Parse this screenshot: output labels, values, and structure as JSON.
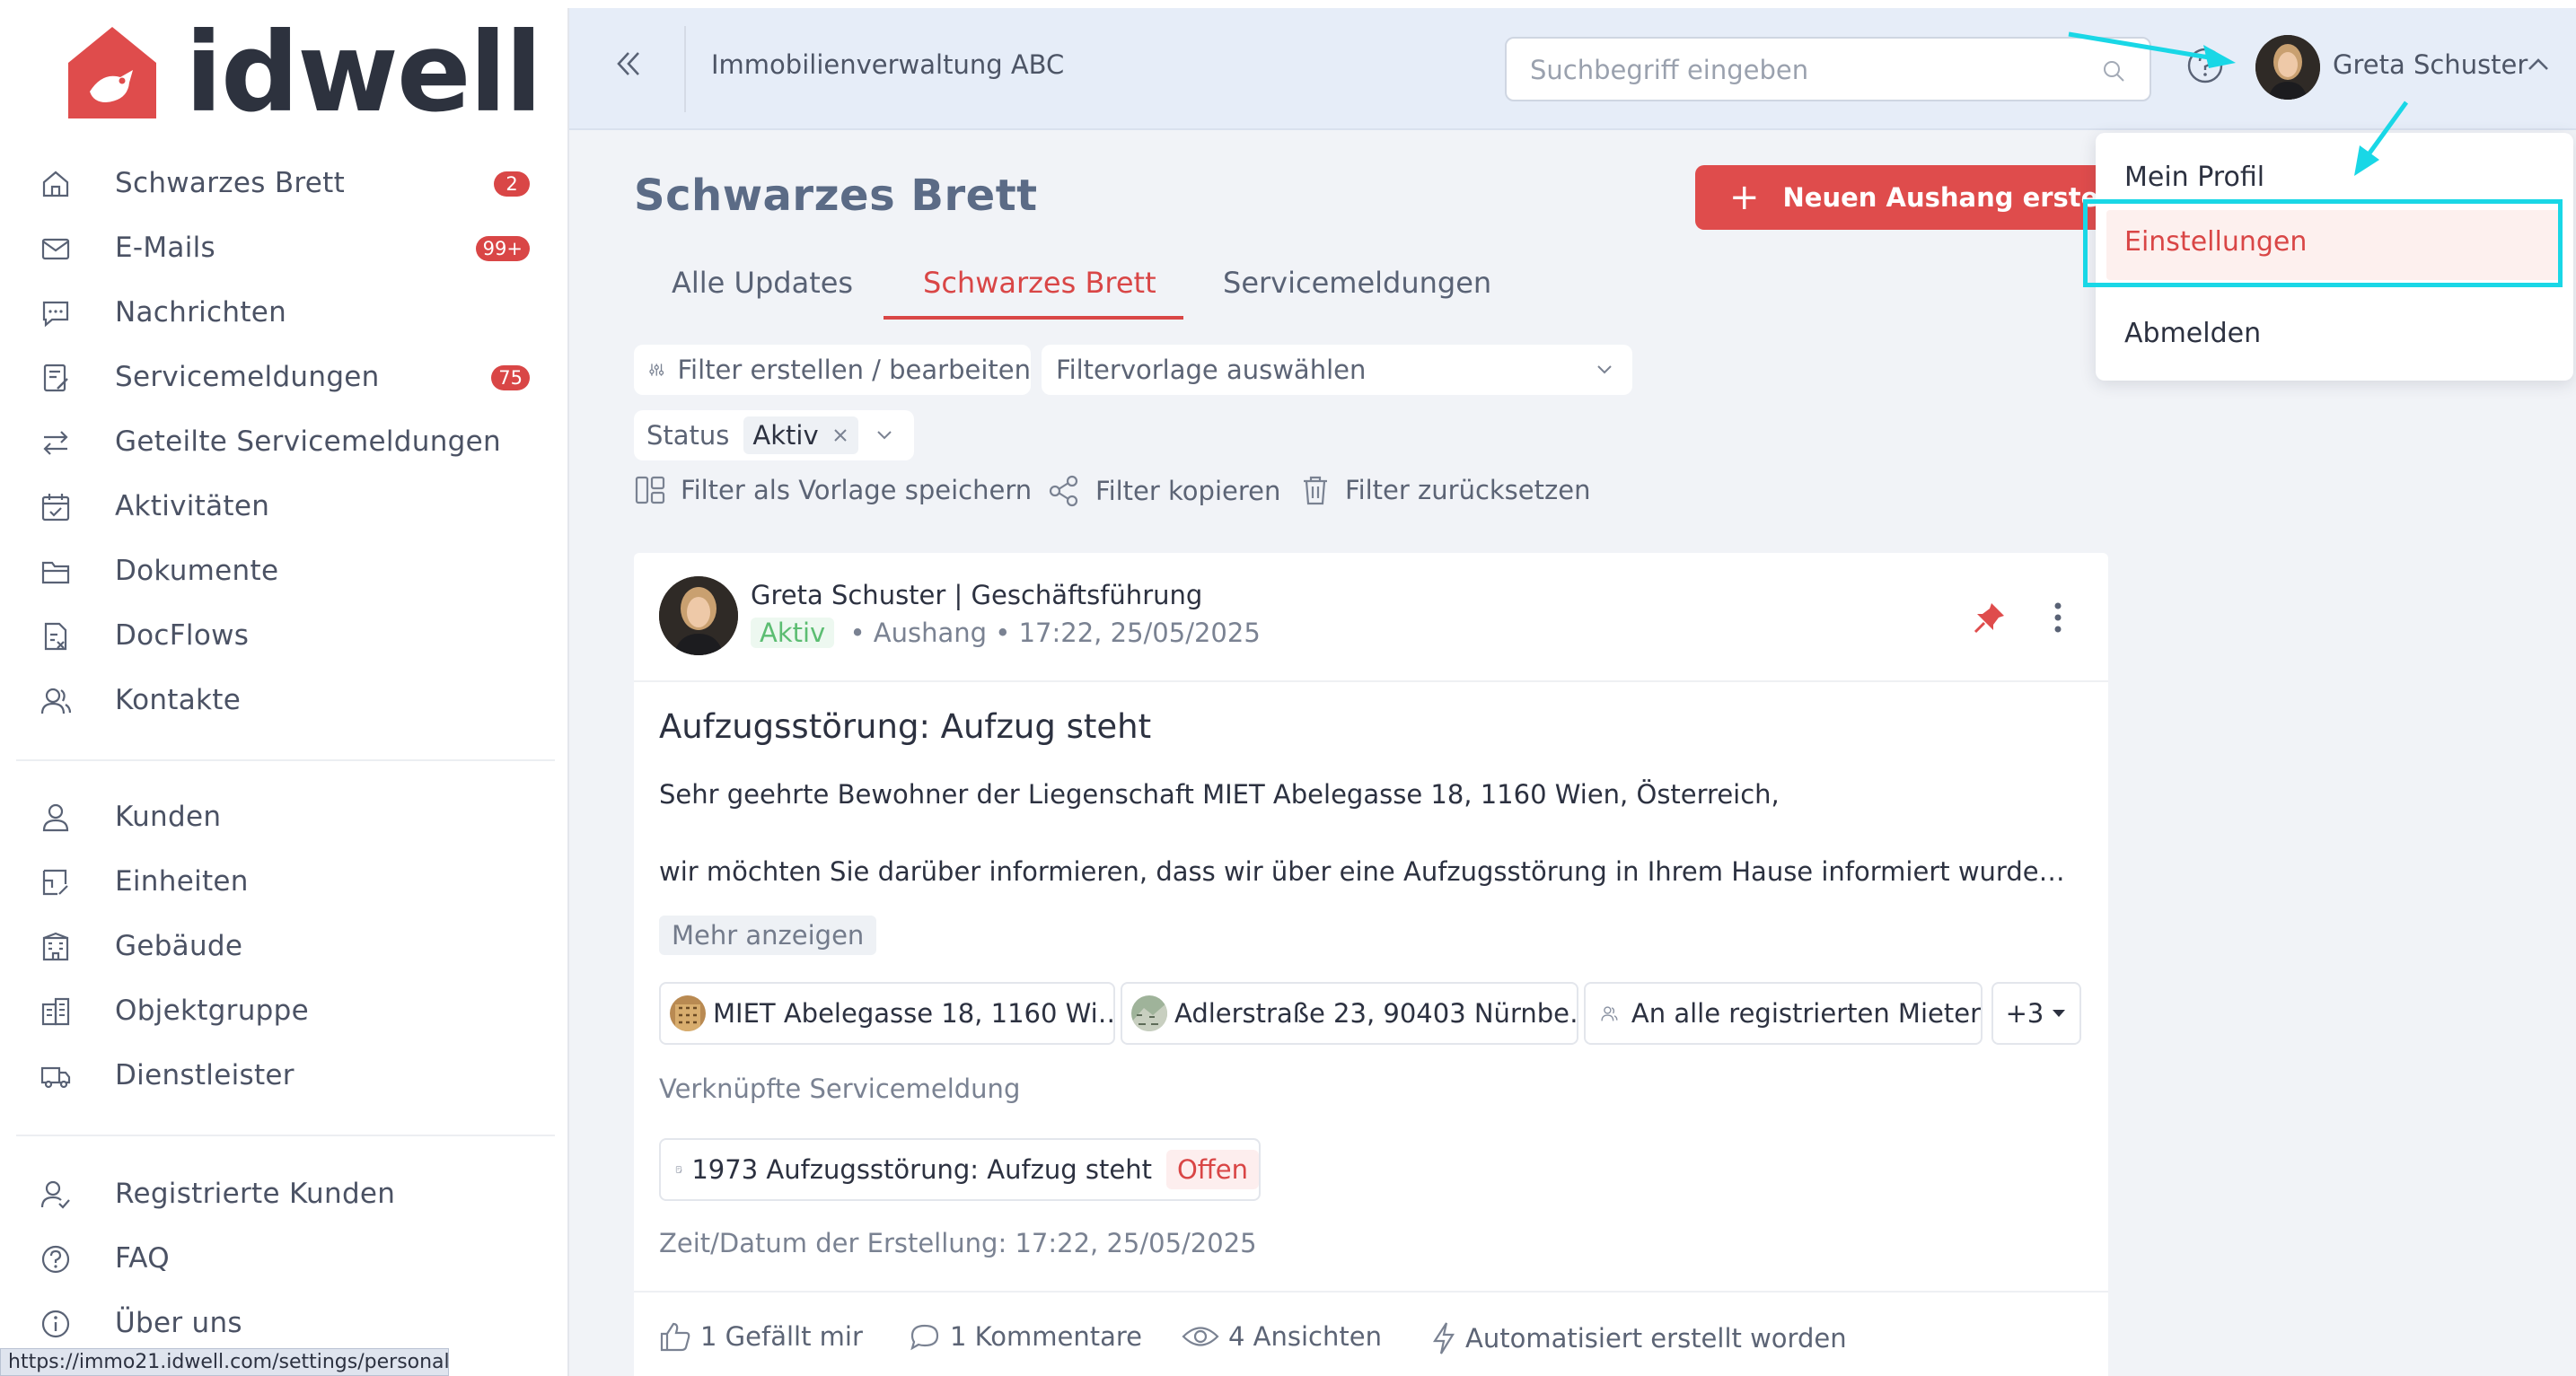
{
  "brand": {
    "name": "idwell",
    "primary": "#df4c4c",
    "logo_color": "#df4c4c",
    "text_color": "#2d323e"
  },
  "sidebar": {
    "groups": [
      [
        {
          "label": "Schwarzes Brett",
          "icon": "home-icon",
          "badge": "2"
        },
        {
          "label": "E-Mails",
          "icon": "mail-icon",
          "badge": "99+"
        },
        {
          "label": "Nachrichten",
          "icon": "chat-icon",
          "badge": ""
        },
        {
          "label": "Servicemeldungen",
          "icon": "service-icon",
          "badge": "75"
        },
        {
          "label": "Geteilte Servicemeldungen",
          "icon": "swap-icon",
          "badge": ""
        },
        {
          "label": "Aktivitäten",
          "icon": "calendar-check-icon",
          "badge": ""
        },
        {
          "label": "Dokumente",
          "icon": "folder-icon",
          "badge": ""
        },
        {
          "label": "DocFlows",
          "icon": "docflow-icon",
          "badge": ""
        },
        {
          "label": "Kontakte",
          "icon": "contacts-icon",
          "badge": ""
        }
      ],
      [
        {
          "label": "Kunden",
          "icon": "user-icon",
          "badge": ""
        },
        {
          "label": "Einheiten",
          "icon": "unit-icon",
          "badge": ""
        },
        {
          "label": "Gebäude",
          "icon": "building-icon",
          "badge": ""
        },
        {
          "label": "Objektgruppe",
          "icon": "object-group-icon",
          "badge": ""
        },
        {
          "label": "Dienstleister",
          "icon": "truck-icon",
          "badge": ""
        }
      ],
      [
        {
          "label": "Registrierte Kunden",
          "icon": "user-check-icon",
          "badge": ""
        },
        {
          "label": "FAQ",
          "icon": "question-icon",
          "badge": ""
        },
        {
          "label": "Über uns",
          "icon": "info-icon",
          "badge": ""
        }
      ]
    ]
  },
  "header": {
    "org": "Immobilienverwaltung ABC",
    "search_placeholder": "Suchbegriff eingeben",
    "user_name": "Greta Schuster"
  },
  "page": {
    "title": "Schwarzes Brett",
    "new_button": "Neuen Aushang erstellen",
    "tabs": [
      {
        "label": "Alle Updates",
        "active": false
      },
      {
        "label": "Schwarzes Brett",
        "active": true
      },
      {
        "label": "Servicemeldungen",
        "active": false
      }
    ],
    "filter_edit": "Filter erstellen / bearbeiten",
    "filter_template_placeholder": "Filtervorlage auswählen",
    "status_label": "Status",
    "status_value": "Aktiv",
    "actions": {
      "save_template": "Filter als Vorlage speichern",
      "copy": "Filter kopieren",
      "reset": "Filter zurücksetzen"
    }
  },
  "post": {
    "author": "Greta Schuster | Geschäftsführung",
    "status": "Aktiv",
    "type": "Aushang",
    "timestamp": "17:22, 25/05/2025",
    "title": "Aufzugsstörung: Aufzug steht",
    "body_line1": "Sehr geehrte Bewohner der Liegenschaft MIET Abelegasse 18, 1160 Wien, Österreich,",
    "body_line2": "wir möchten Sie darüber informieren, dass wir über eine Aufzugsstörung in Ihrem Hause informiert wurden und…",
    "more": "Mehr anzeigen",
    "tags": [
      "MIET Abelegasse 18, 1160 Wi…",
      "Adlerstraße 23, 90403 Nürnbe…",
      "An alle registrierten Mieter"
    ],
    "tags_more": "+3",
    "linked_label": "Verknüpfte Servicemeldung",
    "linked_item": "1973 Aufzugsstörung: Aufzug steht",
    "linked_status": "Offen",
    "created": "Zeit/Datum der Erstellung: 17:22, 25/05/2025",
    "likes": "1 Gefällt mir",
    "comments": "1 Kommentare",
    "views": "4 Ansichten",
    "auto": "Automatisiert erstellt worden"
  },
  "user_menu": {
    "items": [
      "Mein Profil",
      "Einstellungen",
      "Abmelden"
    ],
    "highlighted": "Einstellungen"
  },
  "status_url": "https://immo21.idwell.com/settings/personal",
  "annotation_color": "#19d7e6"
}
